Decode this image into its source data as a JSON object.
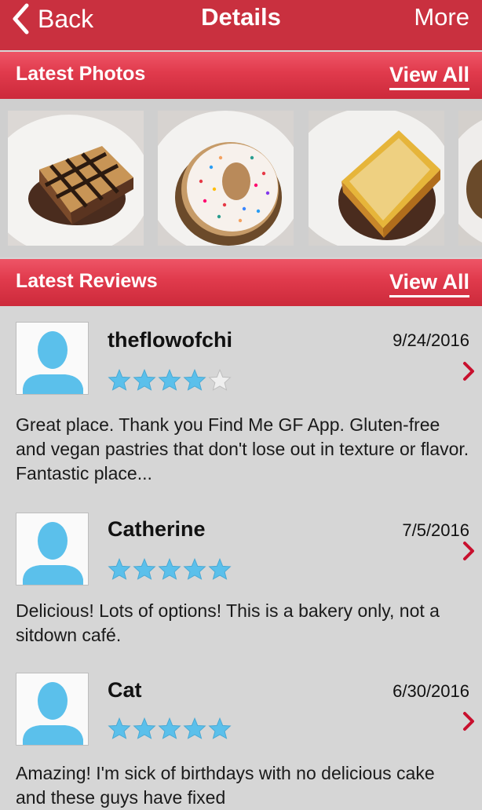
{
  "nav": {
    "back_label": "Back",
    "title": "Details",
    "more_label": "More"
  },
  "photos_section": {
    "title": "Latest Photos",
    "view_all": "View All",
    "items": [
      {
        "icon": "dessert-bar-photo"
      },
      {
        "icon": "sprinkle-donut-photo"
      },
      {
        "icon": "lemon-bar-photo"
      },
      {
        "icon": "cupcake-photo"
      }
    ]
  },
  "reviews_section": {
    "title": "Latest Reviews",
    "view_all": "View All",
    "items": [
      {
        "name": "theflowofchi",
        "date": "9/24/2016",
        "rating": 4,
        "text": "Great place. Thank you Find Me GF App. Gluten-free and vegan pastries that don't lose out in texture or flavor. Fantastic place..."
      },
      {
        "name": "Catherine",
        "date": "7/5/2016",
        "rating": 5,
        "text": "Delicious! Lots of options! This is a bakery only, not a sitdown café."
      },
      {
        "name": "Cat",
        "date": "6/30/2016",
        "rating": 5,
        "text": "Amazing! I'm sick of birthdays with no delicious cake and these guys have fixed"
      }
    ]
  },
  "colors": {
    "nav_red": "#c9303f",
    "header_red": "#e03a4c",
    "star_blue": "#5bc0eb",
    "chevron_red": "#c8102e",
    "avatar_blue": "#5bc0eb"
  }
}
